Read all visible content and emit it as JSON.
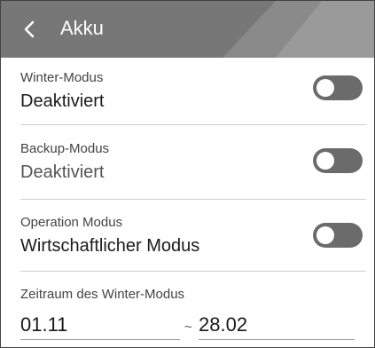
{
  "header": {
    "title": "Akku",
    "back_icon": "chevron-left-icon"
  },
  "settings": [
    {
      "label": "Winter-Modus",
      "value": "Deaktiviert",
      "toggle_on": false
    },
    {
      "label": "Backup-Modus",
      "value": "Deaktiviert",
      "toggle_on": false
    },
    {
      "label": "Operation Modus",
      "value": "Wirtschaftlicher Modus",
      "toggle_on": false
    }
  ],
  "winter_period": {
    "label": "Zeitraum des Winter-Modus",
    "start": "01.11",
    "separator": "~",
    "end": "28.02"
  },
  "colors": {
    "header_bg": "#777777",
    "toggle_off": "#6b6b6b",
    "divider": "#cfcfcf"
  }
}
